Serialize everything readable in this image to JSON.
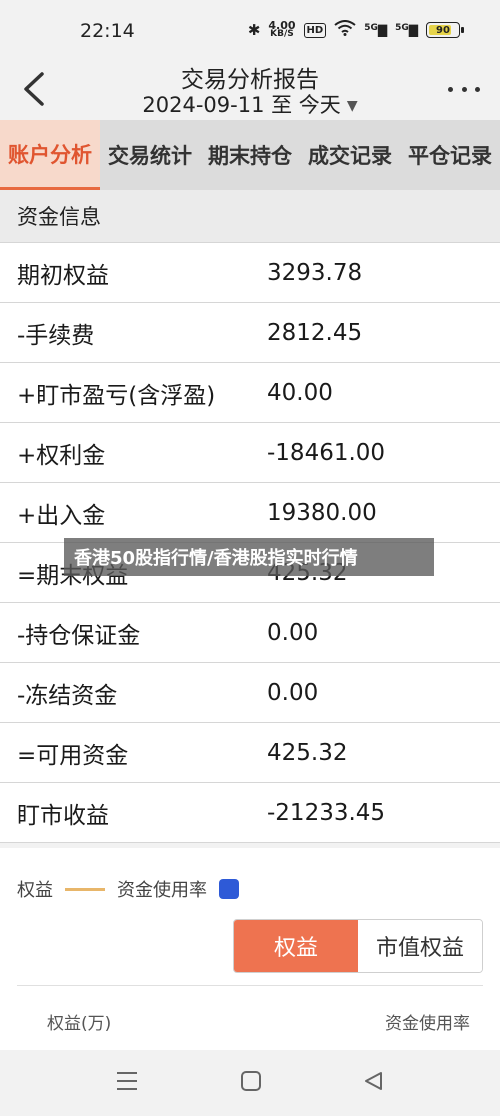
{
  "status_bar": {
    "time": "22:14",
    "net_speed_value": "4.00",
    "net_speed_unit": "KB/S",
    "hd_label": "HD",
    "sim1": "5G",
    "sim2": "5G",
    "battery": "90"
  },
  "header": {
    "title": "交易分析报告",
    "date_range": "2024-09-11 至 今天"
  },
  "tabs": [
    {
      "label": "账户分析",
      "active": true
    },
    {
      "label": "交易统计",
      "active": false
    },
    {
      "label": "期末持仓",
      "active": false
    },
    {
      "label": "成交记录",
      "active": false
    },
    {
      "label": "平仓记录",
      "active": false
    }
  ],
  "section_title": "资金信息",
  "rows": [
    {
      "label": "期初权益",
      "value": "3293.78"
    },
    {
      "label": "-手续费",
      "value": "2812.45"
    },
    {
      "label": "+盯市盈亏(含浮盈)",
      "value": "40.00"
    },
    {
      "label": "+权利金",
      "value": "-18461.00"
    },
    {
      "label": "+出入金",
      "value": "19380.00"
    },
    {
      "label": "=期末权益",
      "value": "425.32"
    },
    {
      "label": "-持仓保证金",
      "value": "0.00"
    },
    {
      "label": "-冻结资金",
      "value": "0.00"
    },
    {
      "label": "=可用资金",
      "value": "425.32"
    },
    {
      "label": "盯市收益",
      "value": "-21233.45"
    }
  ],
  "watermark": "香港50股指行情/香港股指实时行情",
  "chart": {
    "legend_equity": "权益",
    "legend_usage": "资金使用率",
    "legend_equity_color": "#e8b66a",
    "legend_usage_color": "#2e5ad7",
    "toggle": [
      {
        "label": "权益",
        "active": true
      },
      {
        "label": "市值权益",
        "active": false
      }
    ],
    "axis_left_label": "权益(万)",
    "axis_right_label": "资金使用率"
  },
  "colors": {
    "accent": "#ee7350",
    "tab_active_text": "#e05530"
  }
}
